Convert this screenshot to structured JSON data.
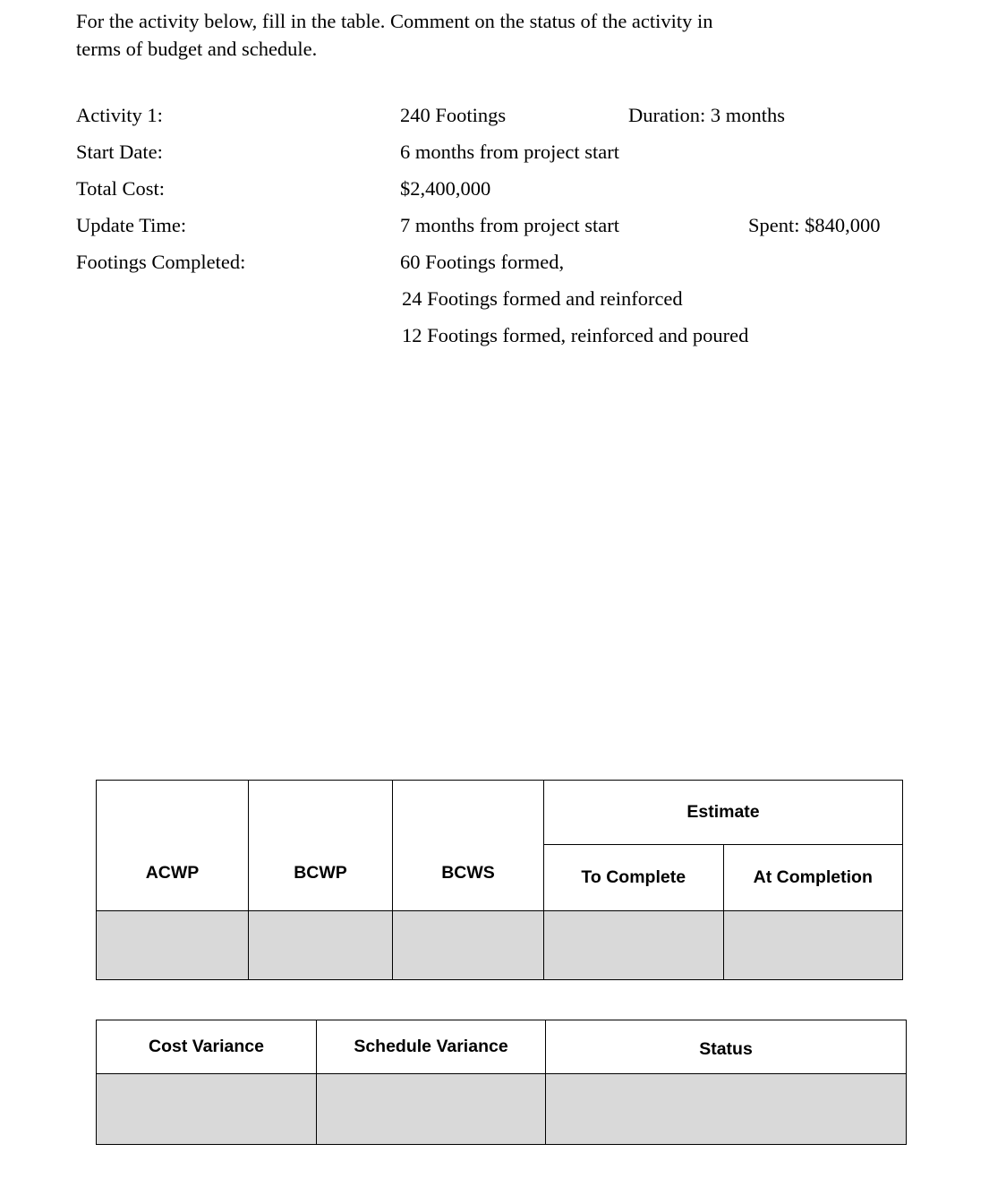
{
  "intro": {
    "line1": "For the activity below, fill in the table. Comment on the status of the activity in",
    "line2": "terms of budget and schedule."
  },
  "details": {
    "rows": [
      {
        "label": "Activity 1:",
        "value": "240 Footings",
        "extra": "Duration: 3 months"
      },
      {
        "label": "Start Date:",
        "value": "6 months from project start",
        "extra": ""
      },
      {
        "label": "Total Cost:",
        "value": "$2,400,000",
        "extra": ""
      },
      {
        "label": "Update Time:",
        "value": "7 months from project start",
        "extra": "Spent: $840,000"
      },
      {
        "label": "Footings Completed:",
        "value": "60 Footings formed,",
        "extra": ""
      }
    ],
    "continuation": [
      "24 Footings formed and reinforced",
      "12 Footings formed, reinforced and poured"
    ]
  },
  "table_earned_value": {
    "group_header": "Estimate",
    "headers": [
      "ACWP",
      "BCWP",
      "BCWS",
      "To Complete",
      "At Completion"
    ],
    "data_row": [
      "",
      "",
      "",
      "",
      ""
    ],
    "fill_color": "#d9d9d9"
  },
  "table_variance": {
    "headers": [
      "Cost Variance",
      "Schedule Variance",
      "Status"
    ],
    "data_row": [
      "",
      "",
      ""
    ],
    "fill_color": "#d9d9d9"
  }
}
